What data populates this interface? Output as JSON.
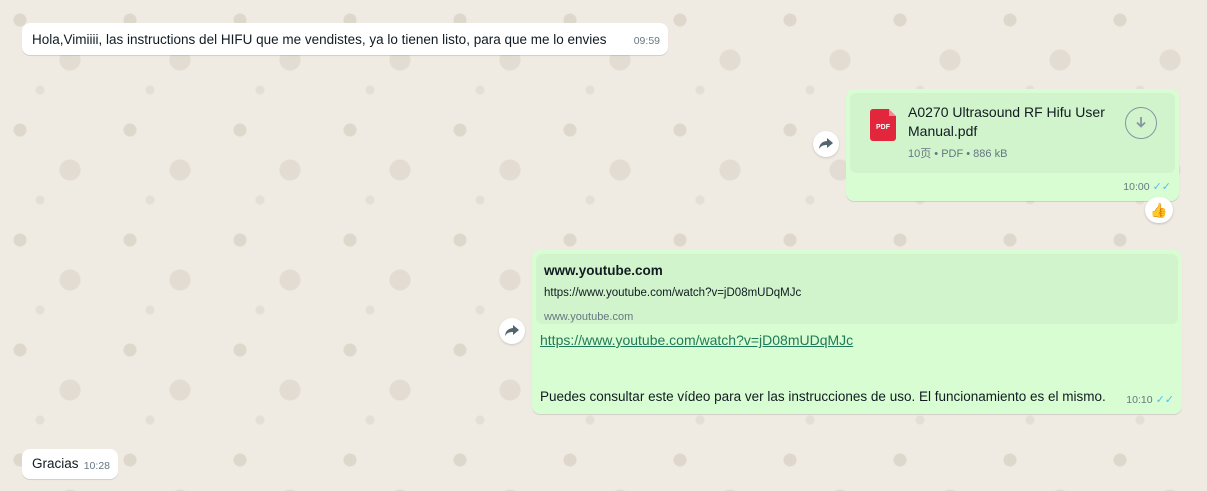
{
  "messages": [
    {
      "text": "Hola,Vimiiii, las instructions del HIFU que me vendistes, ya lo tienen listo, para que me lo envies",
      "time": "09:59"
    },
    {
      "file_name": "A0270 Ultrasound RF Hifu User Manual.pdf",
      "file_meta": "10页 • PDF • 886 kB",
      "file_type_label": "PDF",
      "time": "10:00",
      "reaction": "👍"
    },
    {
      "preview_title": "www.youtube.com",
      "preview_url": "https://www.youtube.com/watch?v=jD08mUDqMJc",
      "preview_domain": "www.youtube.com",
      "link": "https://www.youtube.com/watch?v=jD08mUDqMJc",
      "text": "Puedes consultar este vídeo para ver las instrucciones de uso. El funcionamiento es el mismo.",
      "time": "10:10"
    },
    {
      "text": "Gracias",
      "time": "10:28"
    }
  ],
  "icons": {
    "forward": "forward-icon",
    "download": "download-icon",
    "read_receipt": "double-check-icon",
    "read_color": "#53bdeb"
  }
}
